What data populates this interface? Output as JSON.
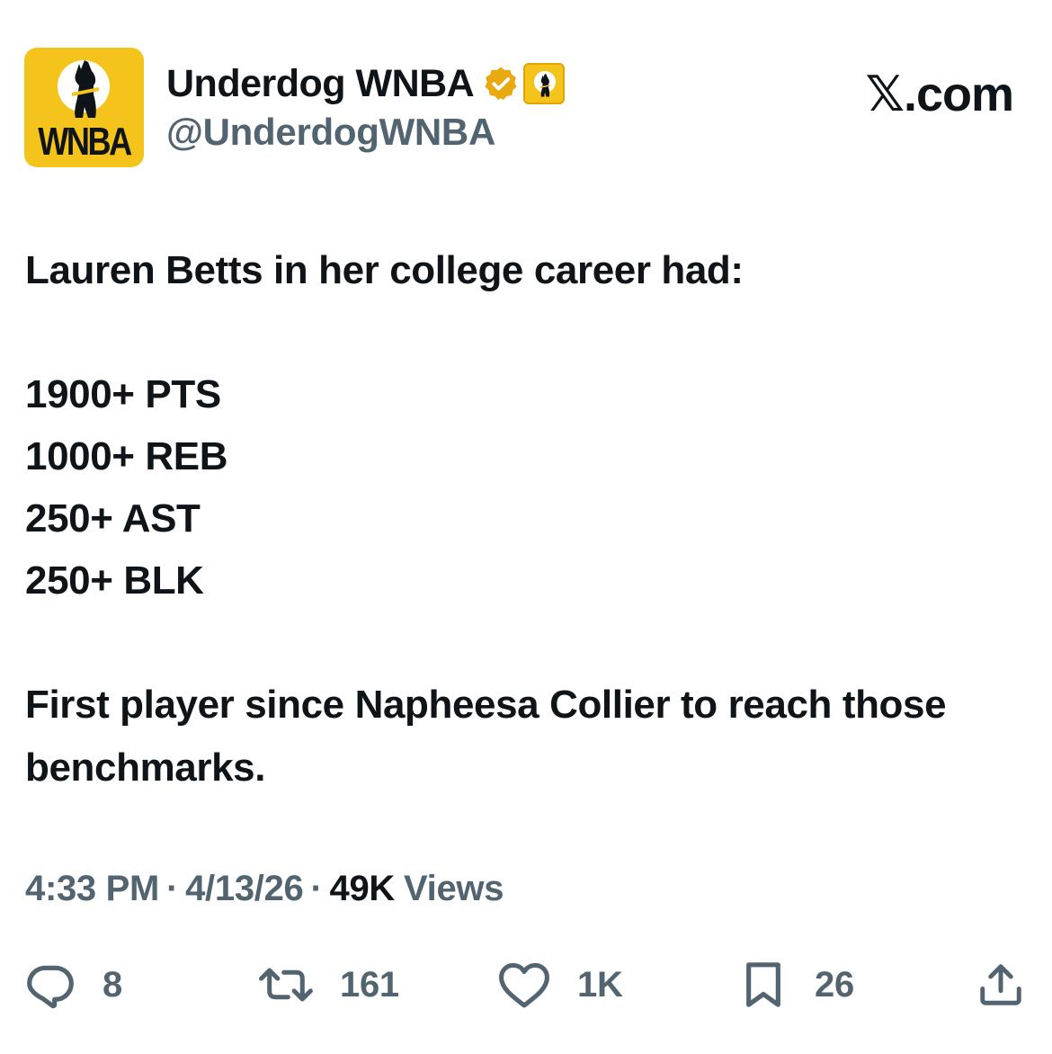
{
  "author": {
    "display_name": "Underdog WNBA",
    "handle": "@UnderdogWNBA",
    "avatar_text": "WNBA",
    "avatar_color": "#f5c41c",
    "verified_color": "#e8a911"
  },
  "source": "𝕏.com",
  "tweet": {
    "line1": "Lauren Betts in her college career had:",
    "stats": [
      "1900+ PTS",
      "1000+ REB",
      "250+ AST",
      "250+ BLK"
    ],
    "closing": "First player since Napheesa Collier to reach those benchmarks."
  },
  "meta": {
    "time": "4:33 PM",
    "date": "4/13/26",
    "views_count": "49K",
    "views_label": "Views",
    "separator": "·"
  },
  "actions": {
    "replies": "8",
    "reposts": "161",
    "likes": "1K",
    "bookmarks": "26"
  },
  "icons": {
    "reply": "reply-icon",
    "repost": "repost-icon",
    "like": "heart-icon",
    "bookmark": "bookmark-icon",
    "share": "share-icon",
    "verified": "verified-badge-icon"
  }
}
